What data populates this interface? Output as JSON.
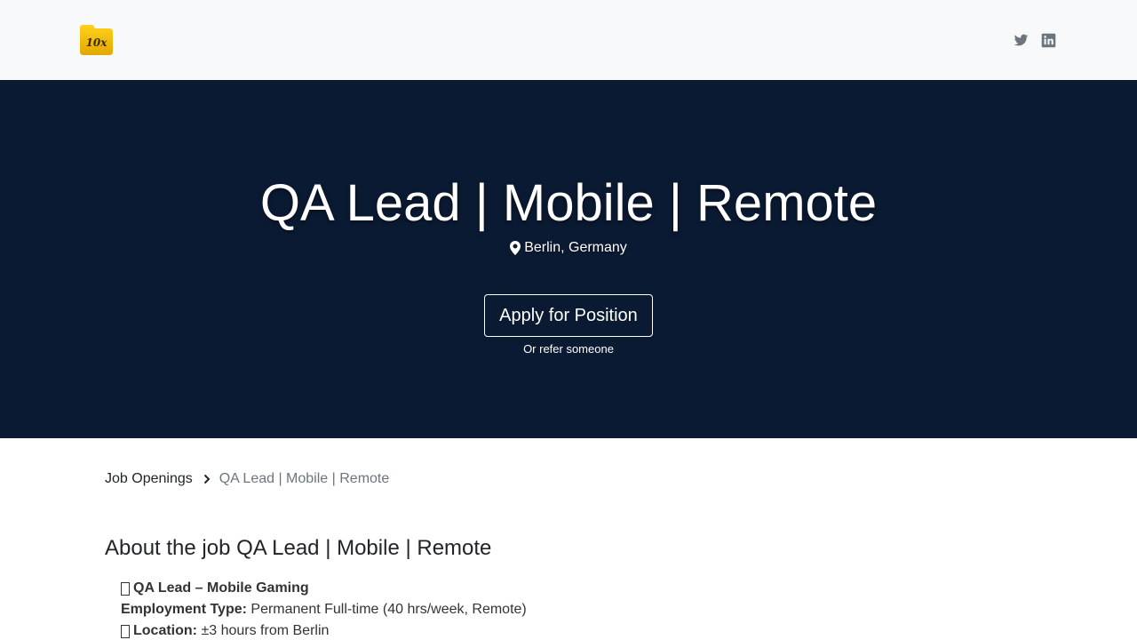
{
  "header": {
    "logo_text": "10x",
    "social": [
      {
        "name": "twitter-icon",
        "label": "Twitter"
      },
      {
        "name": "linkedin-icon",
        "label": "LinkedIn"
      }
    ]
  },
  "hero": {
    "title": "QA Lead | Mobile | Remote",
    "location": "Berlin, Germany",
    "apply_label": "Apply for Position",
    "refer_label": "Or refer someone"
  },
  "breadcrumb": {
    "parent": "Job Openings",
    "current": "QA Lead | Mobile | Remote"
  },
  "about": {
    "title": "About the job QA Lead | Mobile | Remote",
    "lines": [
      {
        "label": "QA Lead – Mobile Gaming",
        "value": ""
      },
      {
        "label": "Employment Type:",
        "value": "Permanent Full-time (40 hrs/week, Remote)"
      },
      {
        "label": "Location:",
        "value": "±3 hours from Berlin"
      }
    ]
  },
  "colors": {
    "hero_bg": "#0b1a33",
    "topbar_bg": "#f8f9fa",
    "logo_yellow": "#f5c400"
  }
}
